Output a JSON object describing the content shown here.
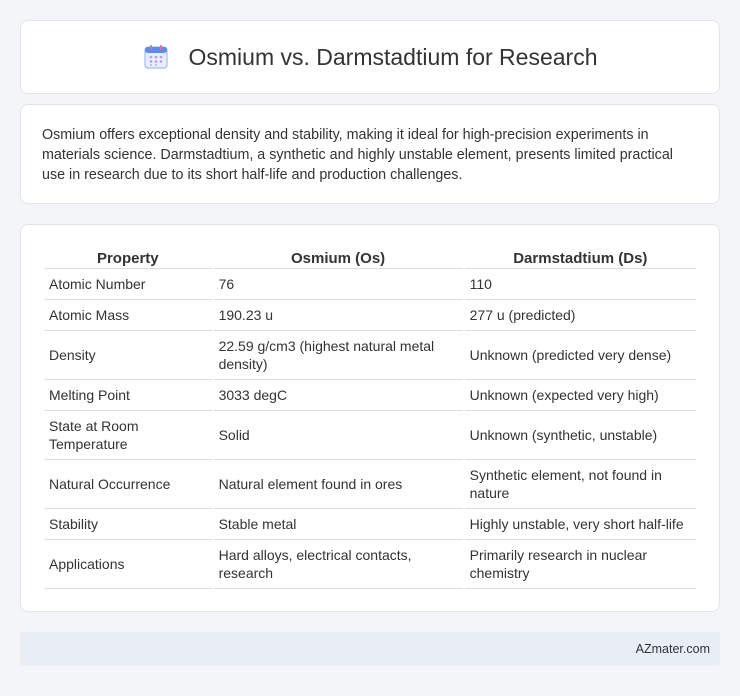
{
  "header": {
    "icon": "calendar-icon",
    "title": "Osmium vs. Darmstadtium for Research"
  },
  "summary": {
    "text": "Osmium offers exceptional density and stability, making it ideal for high-precision experiments in materials science. Darmstadtium, a synthetic and highly unstable element, presents limited practical use in research due to its short half-life and production challenges."
  },
  "table": {
    "headers": [
      "Property",
      "Osmium (Os)",
      "Darmstadtium (Ds)"
    ],
    "rows": [
      [
        "Atomic Number",
        "76",
        "110"
      ],
      [
        "Atomic Mass",
        "190.23 u",
        "277 u (predicted)"
      ],
      [
        "Density",
        "22.59 g/cm3 (highest natural metal density)",
        "Unknown (predicted very dense)"
      ],
      [
        "Melting Point",
        "3033 degC",
        "Unknown (expected very high)"
      ],
      [
        "State at Room Temperature",
        "Solid",
        "Unknown (synthetic, unstable)"
      ],
      [
        "Natural Occurrence",
        "Natural element found in ores",
        "Synthetic element, not found in nature"
      ],
      [
        "Stability",
        "Stable metal",
        "Highly unstable, very short half-life"
      ],
      [
        "Applications",
        "Hard alloys, electrical contacts, research",
        "Primarily research in nuclear chemistry"
      ]
    ]
  },
  "footer": {
    "text": "AZmater.com"
  },
  "colors": {
    "background": "#f3f5f9",
    "card": "#ffffff",
    "footer_bg": "#e8edf6",
    "icon_blue": "#5b8def",
    "icon_pink": "#e96a8b"
  }
}
